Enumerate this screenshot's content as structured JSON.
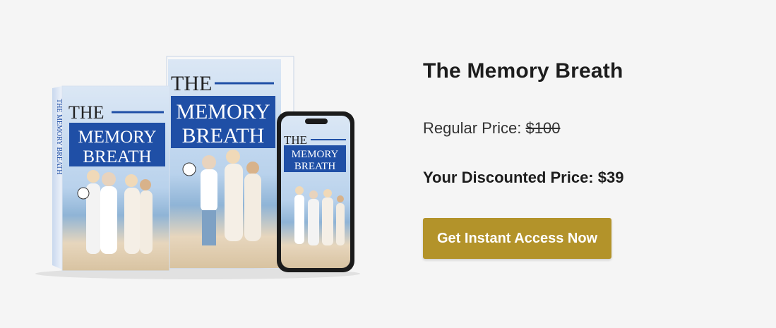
{
  "product": {
    "image_alt": "The Memory Breath book, ebook and mobile bundle",
    "cover_line1": "THE",
    "cover_line2": "MEMORY",
    "cover_line3": "BREATH",
    "spine_text": "THE MEMORY BREATH"
  },
  "offer": {
    "title": "The Memory Breath",
    "regular_label": "Regular Price:",
    "regular_price": "$100",
    "discount_text": "Your Discounted Price: $39",
    "cta_label": "Get Instant Access Now"
  },
  "colors": {
    "background": "#f5f5f5",
    "button": "#b3932a",
    "cover_blue": "#1f4fa6"
  }
}
